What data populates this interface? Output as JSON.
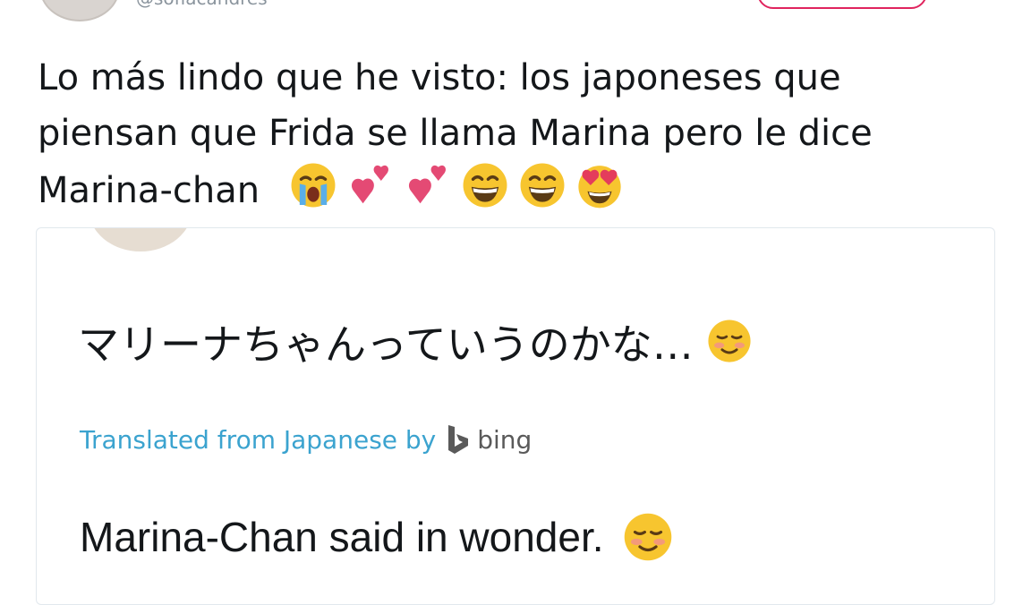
{
  "header": {
    "handle": "@sofiacandres",
    "follow_label": ""
  },
  "tweet": {
    "text": "Lo más lindo que he visto: los japoneses que piensan que Frida se llama Marina pero le dice Marina-chan",
    "emojis": [
      "crying-face",
      "two-hearts",
      "two-hearts",
      "grinning-face",
      "grinning-face",
      "heart-eyes-face"
    ]
  },
  "quoted": {
    "text_jp": "マリーナちゃんっていうのかな…",
    "translated_label": "Translated from Japanese by",
    "translator": "bing",
    "text_en": "Marina-Chan said in wonder."
  },
  "colors": {
    "accent_like": "#e0245e",
    "link_blue": "#3ba3cf",
    "card_border": "#e1e8ed"
  }
}
